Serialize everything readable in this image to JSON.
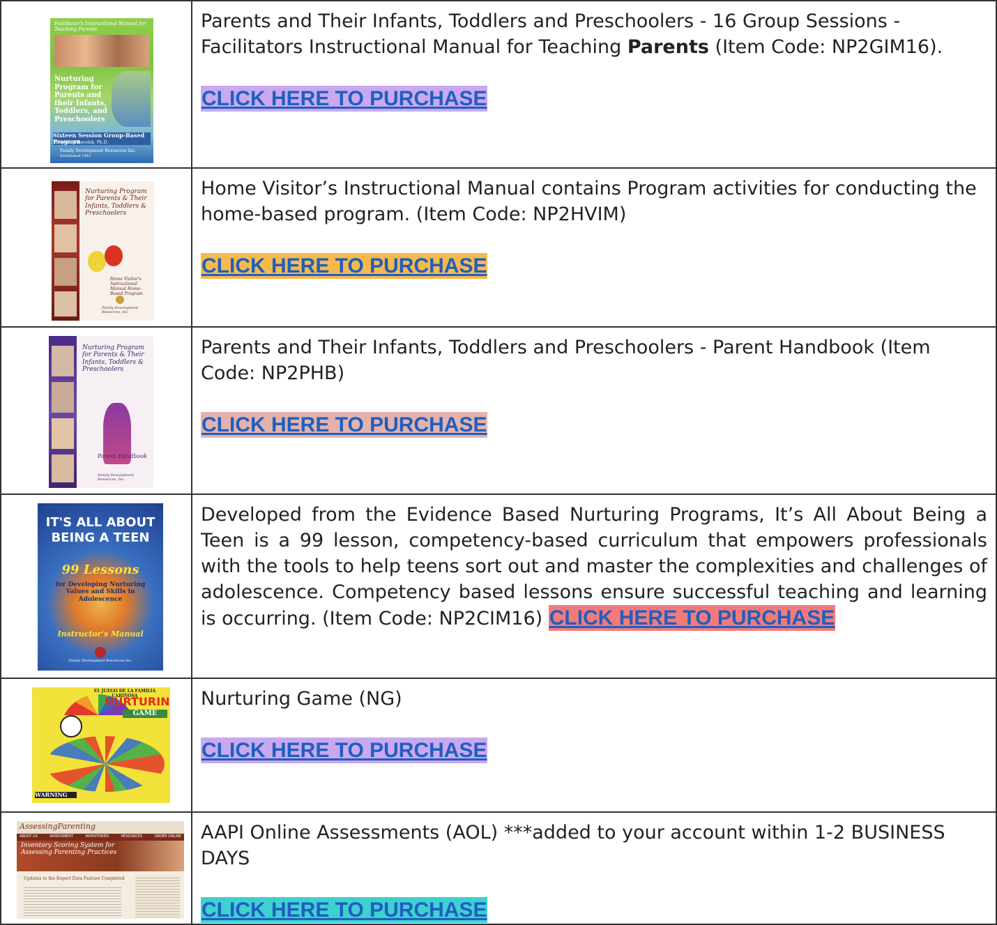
{
  "rows": [
    {
      "desc_before": "Parents and Their Infants, Toddlers and Preschoolers - 16 Group Sessions - Facilitators Instructional Manual for Teaching ",
      "desc_bold": "Parents",
      "desc_after": " (Item Code: NP2GIM16).",
      "buy_label": "CLICK HERE TO PURCHASE",
      "buy_bg": "#c9a8f0",
      "cover": {
        "top_text": "Facilitator's Instructional Manual for Teaching Parents",
        "title": "Nurturing Program for Parents and their Infants, Toddlers, and Preschoolers",
        "subtitle": "Sixteen Session Group-Based Program",
        "author": "Stephen J. Bavolek, Ph.D.",
        "publisher": "Family Development Resources Inc.",
        "est": "Established 1983"
      }
    },
    {
      "desc": "Home Visitor’s Instructional Manual contains Program activities for conducting the home-based program. (Item Code: NP2HVIM)",
      "buy_label": "CLICK HERE TO PURCHASE",
      "buy_bg": "#f5b94e",
      "cover": {
        "title": "Nurturing Program for Parents & Their Infants, Toddlers & Preschoolers",
        "subtitle": "Home Visitor's Instructional Manual Home-Based Program",
        "publisher": "Family Development Resources, Inc."
      }
    },
    {
      "desc": "Parents and Their Infants, Toddlers and Preschoolers - Parent Handbook (Item Code: NP2PHB)",
      "buy_label": "CLICK HERE TO PURCHASE",
      "buy_bg": "#e3b2ad",
      "cover": {
        "title": "Nurturing Program for Parents & Their Infants, Toddlers & Preschoolers",
        "subtitle": "Parent Handbook",
        "publisher": "Family Development Resources, Inc."
      }
    },
    {
      "desc": "Developed from the Evidence Based Nurturing Programs, It’s All About Being a Teen is a 99 lesson, competency-based curriculum that empowers professionals with the tools to help teens sort out and master the complexities and challenges of adolescence. Competency based lessons ensure successful teaching and learning is occurring. (Item Code: NP2CIM16) ",
      "buy_label": "CLICK HERE TO PURCHASE",
      "buy_bg": "#f47a7a",
      "cover": {
        "title1": "IT'S ALL ABOUT",
        "title2": "BEING A TEEN",
        "lessons": "99 Lessons",
        "sub": "for Developing Nurturing Values and Skills in Adolescence",
        "manual": "Instructor's Manual",
        "publisher": "Family Development Resources Inc."
      }
    },
    {
      "desc": "Nurturing Game (NG)",
      "buy_label": "CLICK HERE TO PURCHASE",
      "buy_bg": "#c9a8f0",
      "cover": {
        "top": "EL JUEGO DE LA FAMILIA CARIÑOSA",
        "title": "NURTURING",
        "game": "GAME",
        "warning": "WARNING"
      }
    },
    {
      "desc": "AAPI Online Assessments (AOL) ***added to your account within 1-2 BUSINESS DAYS",
      "buy_label": "CLICK HERE TO PURCHASE",
      "buy_bg": "#3fd0d0",
      "cover": {
        "logo": "AssessingParenting",
        "nav": [
          "ABOUT US",
          "ASSESSMENT",
          "INVENTORIES",
          "RESOURCES",
          "ORDER ONLINE"
        ],
        "headline": "Inventory Scoring System for Assessing Parenting Practices",
        "news": "Updates to the Report Data Feature Completed"
      }
    }
  ]
}
